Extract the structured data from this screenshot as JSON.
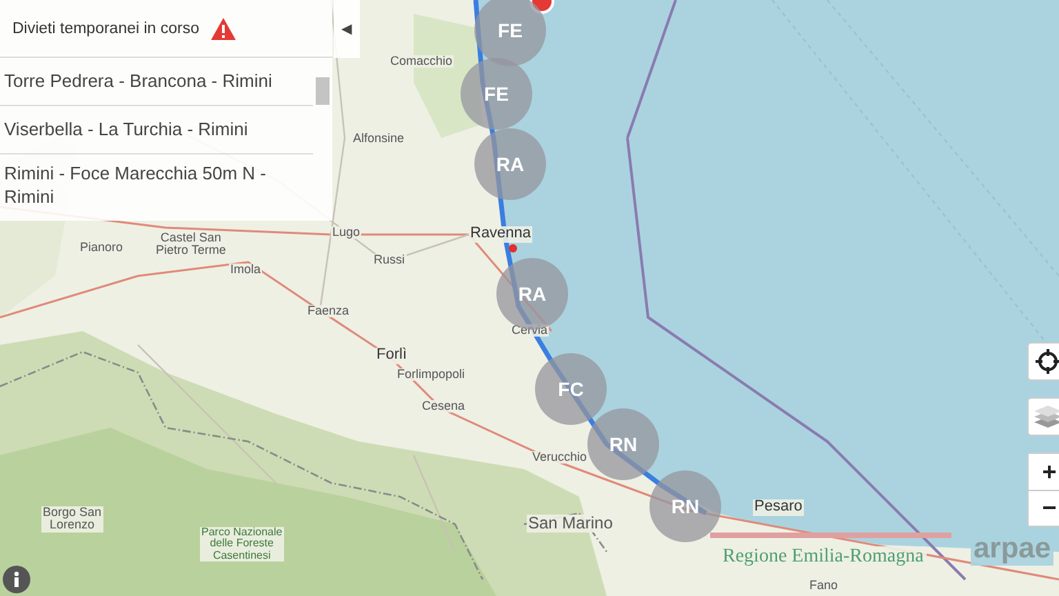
{
  "panel": {
    "title": "Divieti temporanei in corso",
    "collapse_button": "◀",
    "items": [
      {
        "text": "Torre Pedrera - Brancona - Rimini"
      },
      {
        "text": "Viserbella - La Turchia - Rimini"
      },
      {
        "text": "Rimini - Foce Marecchia 50m N - Rimini"
      }
    ]
  },
  "map": {
    "places": [
      {
        "text": "Comacchio",
        "kind": "town"
      },
      {
        "text": "Alfonsine",
        "kind": "town"
      },
      {
        "text": "Lugo",
        "kind": "town"
      },
      {
        "text": "Ravenna",
        "kind": "city"
      },
      {
        "text": "Castel San\nPietro Terme",
        "kind": "town"
      },
      {
        "text": "Russi",
        "kind": "town"
      },
      {
        "text": "Imola",
        "kind": "town"
      },
      {
        "text": "Pianoro",
        "kind": "town"
      },
      {
        "text": "Faenza",
        "kind": "town"
      },
      {
        "text": "Forlì",
        "kind": "city"
      },
      {
        "text": "Forlimpopoli",
        "kind": "town"
      },
      {
        "text": "Cesena",
        "kind": "town"
      },
      {
        "text": "Cervia",
        "kind": "town"
      },
      {
        "text": "Verucchio",
        "kind": "town"
      },
      {
        "text": "San Marino",
        "kind": "country"
      },
      {
        "text": "Borgo San\nLorenzo",
        "kind": "town"
      },
      {
        "text": "Parco Nazionale\ndelle Foreste\nCasentinesi",
        "kind": "park"
      },
      {
        "text": "Pesaro",
        "kind": "city"
      },
      {
        "text": "Fano",
        "kind": "town"
      }
    ],
    "clusters": [
      {
        "label": "FE"
      },
      {
        "label": "FE"
      },
      {
        "label": "RA"
      },
      {
        "label": "RA"
      },
      {
        "label": "FC"
      },
      {
        "label": "RN"
      },
      {
        "label": "RN"
      }
    ],
    "controls": {
      "zoom_in": "+",
      "zoom_out": "−"
    },
    "logos": {
      "region": "Regione Emilia-Romagna",
      "agency": "arpae"
    }
  }
}
